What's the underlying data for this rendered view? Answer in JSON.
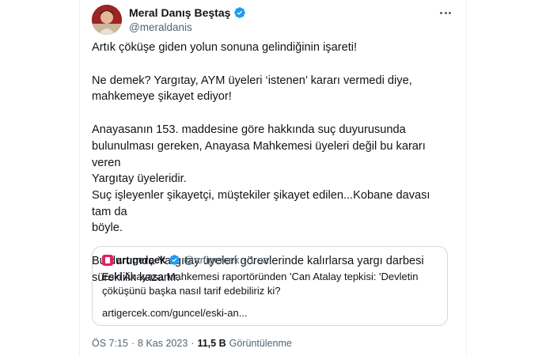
{
  "tweet": {
    "author": {
      "display_name": "Meral Danış Beştaş",
      "handle": "@meraldanis",
      "verified_icon": "verified-badge-icon"
    },
    "paragraphs": [
      [
        "Artık çöküşe giden yolun sonuna gelindiğinin işareti!"
      ],
      [
        "Ne demek? Yargıtay, AYM üyeleri ‘istenen’ kararı vermedi diye,",
        "mahkemeye şikayet ediyor!"
      ],
      [
        "Anayasanın 153. maddesine göre hakkında suç duyurusunda",
        "bulunulması gereken, Anayasa Mahkemesi üyeleri değil bu kararı veren",
        "Yargıtay üyeleridir.",
        "Suç işleyenler şikayetçi, müştekiler şikayet edilen...Kobane davası tam da",
        "böyle."
      ],
      [
        "Bu durumda Yargıtay üyeleri görevlerinde kalırlarsa yargı darbesi",
        "süreklilik kazanır."
      ]
    ],
    "quote": {
      "name": "artıgerçek",
      "handle": "@artigercek",
      "separator": "·",
      "time": "1 sa",
      "text": "Eski Anayasa Mahkemesi raportöründen 'Can Atalay tepkisi: 'Devletin çöküşünü başka nasıl tarif edebiliriz ki?",
      "link": "artigercek.com/guncel/eski-an..."
    },
    "meta": {
      "time": "ÖS 7:15",
      "separator": "·",
      "date": "8 Kas 2023",
      "views_count": "11,5 B",
      "views_label": "Görüntülenme"
    }
  },
  "colors": {
    "text_primary": "#0f1419",
    "text_secondary": "#536471",
    "verified": "#1d9bf0",
    "border": "#cfd9de"
  }
}
